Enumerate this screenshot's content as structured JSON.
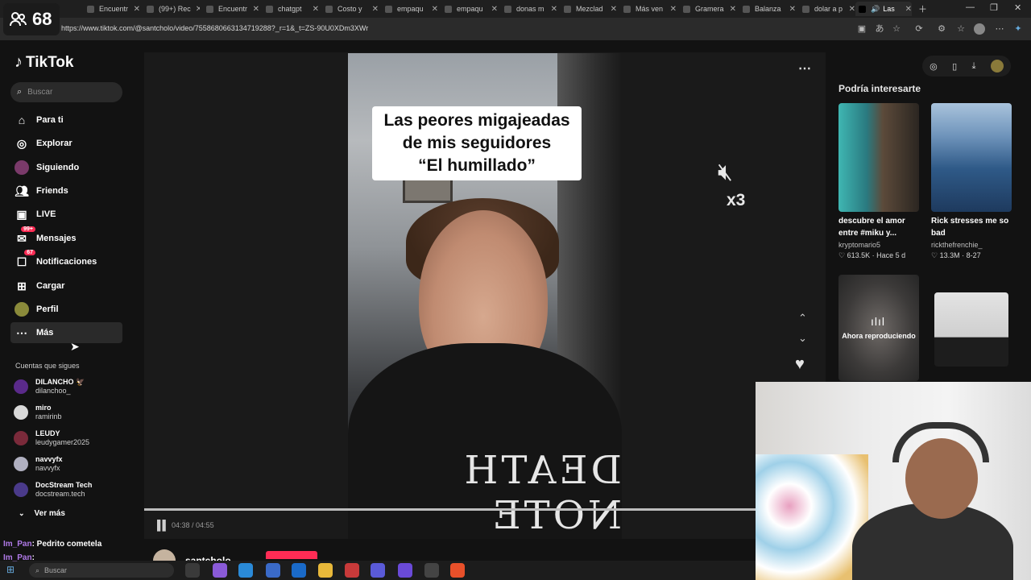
{
  "stream_overlay": {
    "viewer_count": "68",
    "chat": [
      {
        "user": "Im_Pan",
        "message": ": Pedrito cometela"
      },
      {
        "user": "Im_Pan",
        "message": ":"
      }
    ]
  },
  "browser": {
    "tabs": [
      {
        "label": "Encuentr"
      },
      {
        "label": "(99+) Rec"
      },
      {
        "label": "Encuentr"
      },
      {
        "label": "chatgpt"
      },
      {
        "label": "Costo y"
      },
      {
        "label": "empaqu"
      },
      {
        "label": "empaqu"
      },
      {
        "label": "donas m"
      },
      {
        "label": "Mezclad"
      },
      {
        "label": "Más ven"
      },
      {
        "label": "Gramera"
      },
      {
        "label": "Balanza"
      },
      {
        "label": "dolar a p"
      },
      {
        "label": "Las"
      }
    ],
    "url": "https://www.tiktok.com/@santcholo/video/7558680663134719288?_r=1&_t=ZS-90U0XDm3XWr"
  },
  "tiktok": {
    "brand": "TikTok",
    "search_placeholder": "Buscar",
    "nav": [
      {
        "label": "Para ti",
        "icon": "home-icon"
      },
      {
        "label": "Explorar",
        "icon": "compass-icon"
      },
      {
        "label": "Siguiendo",
        "icon": "following-avatar"
      },
      {
        "label": "Friends",
        "icon": "friends-icon"
      },
      {
        "label": "LIVE",
        "icon": "live-icon"
      },
      {
        "label": "Mensajes",
        "icon": "messages-icon",
        "badge": "99+"
      },
      {
        "label": "Notificaciones",
        "icon": "notifications-icon",
        "badge": "67"
      },
      {
        "label": "Cargar",
        "icon": "upload-icon"
      },
      {
        "label": "Perfil",
        "icon": "profile-avatar"
      },
      {
        "label": "Más",
        "icon": "more-icon"
      }
    ],
    "following_title": "Cuentas que sigues",
    "following": [
      {
        "name": "DILANCHO 🦅",
        "username": "dilanchoo_",
        "color": "#5a2a8a"
      },
      {
        "name": "miro",
        "username": "ramirinb",
        "color": "#d8d8d8"
      },
      {
        "name": "LEUDY",
        "username": "leudygamer2025",
        "color": "#7a2a3a"
      },
      {
        "name": "navvyfx",
        "username": "navvyfx",
        "color": "#b0b0c0"
      },
      {
        "name": "DocStream Tech",
        "username": "docstream.tech",
        "color": "#4a3a8a"
      }
    ],
    "see_more": "Ver más"
  },
  "video": {
    "caption_lines": [
      "Las peores migajeadas",
      "de mis seguidores",
      "“El humillado”"
    ],
    "hoodie_text": "DEATH NOTE",
    "overlay_badge": "x3",
    "current_time": "04:38",
    "duration": "04:55",
    "separator": " / ",
    "progress": 0.94,
    "author": "santcholo"
  },
  "recommendations": {
    "title": "Podría interesarte",
    "items": [
      {
        "title_lines": [
          "descubre el amor",
          "entre #miku y..."
        ],
        "author": "kryptomario5",
        "likes": "613.5K",
        "date": "Hace 5 d"
      },
      {
        "title_lines": [
          "Rick stresses me so",
          "bad"
        ],
        "author": "rickthefrenchie_",
        "likes": "13.3M",
        "date": "8-27"
      }
    ],
    "now_playing_label": "Ahora reproduciendo"
  },
  "taskbar": {
    "search_placeholder": "Buscar"
  }
}
